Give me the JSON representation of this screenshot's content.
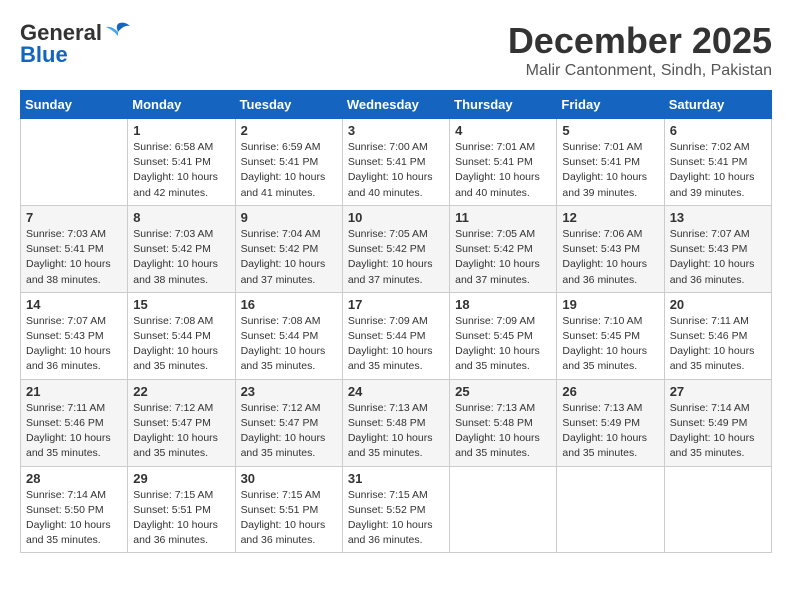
{
  "header": {
    "logo_line1": "General",
    "logo_line2": "Blue",
    "title": "December 2025",
    "subtitle": "Malir Cantonment, Sindh, Pakistan"
  },
  "weekdays": [
    "Sunday",
    "Monday",
    "Tuesday",
    "Wednesday",
    "Thursday",
    "Friday",
    "Saturday"
  ],
  "weeks": [
    [
      {
        "day": "",
        "info": ""
      },
      {
        "day": "1",
        "info": "Sunrise: 6:58 AM\nSunset: 5:41 PM\nDaylight: 10 hours\nand 42 minutes."
      },
      {
        "day": "2",
        "info": "Sunrise: 6:59 AM\nSunset: 5:41 PM\nDaylight: 10 hours\nand 41 minutes."
      },
      {
        "day": "3",
        "info": "Sunrise: 7:00 AM\nSunset: 5:41 PM\nDaylight: 10 hours\nand 40 minutes."
      },
      {
        "day": "4",
        "info": "Sunrise: 7:01 AM\nSunset: 5:41 PM\nDaylight: 10 hours\nand 40 minutes."
      },
      {
        "day": "5",
        "info": "Sunrise: 7:01 AM\nSunset: 5:41 PM\nDaylight: 10 hours\nand 39 minutes."
      },
      {
        "day": "6",
        "info": "Sunrise: 7:02 AM\nSunset: 5:41 PM\nDaylight: 10 hours\nand 39 minutes."
      }
    ],
    [
      {
        "day": "7",
        "info": "Sunrise: 7:03 AM\nSunset: 5:41 PM\nDaylight: 10 hours\nand 38 minutes."
      },
      {
        "day": "8",
        "info": "Sunrise: 7:03 AM\nSunset: 5:42 PM\nDaylight: 10 hours\nand 38 minutes."
      },
      {
        "day": "9",
        "info": "Sunrise: 7:04 AM\nSunset: 5:42 PM\nDaylight: 10 hours\nand 37 minutes."
      },
      {
        "day": "10",
        "info": "Sunrise: 7:05 AM\nSunset: 5:42 PM\nDaylight: 10 hours\nand 37 minutes."
      },
      {
        "day": "11",
        "info": "Sunrise: 7:05 AM\nSunset: 5:42 PM\nDaylight: 10 hours\nand 37 minutes."
      },
      {
        "day": "12",
        "info": "Sunrise: 7:06 AM\nSunset: 5:43 PM\nDaylight: 10 hours\nand 36 minutes."
      },
      {
        "day": "13",
        "info": "Sunrise: 7:07 AM\nSunset: 5:43 PM\nDaylight: 10 hours\nand 36 minutes."
      }
    ],
    [
      {
        "day": "14",
        "info": "Sunrise: 7:07 AM\nSunset: 5:43 PM\nDaylight: 10 hours\nand 36 minutes."
      },
      {
        "day": "15",
        "info": "Sunrise: 7:08 AM\nSunset: 5:44 PM\nDaylight: 10 hours\nand 35 minutes."
      },
      {
        "day": "16",
        "info": "Sunrise: 7:08 AM\nSunset: 5:44 PM\nDaylight: 10 hours\nand 35 minutes."
      },
      {
        "day": "17",
        "info": "Sunrise: 7:09 AM\nSunset: 5:44 PM\nDaylight: 10 hours\nand 35 minutes."
      },
      {
        "day": "18",
        "info": "Sunrise: 7:09 AM\nSunset: 5:45 PM\nDaylight: 10 hours\nand 35 minutes."
      },
      {
        "day": "19",
        "info": "Sunrise: 7:10 AM\nSunset: 5:45 PM\nDaylight: 10 hours\nand 35 minutes."
      },
      {
        "day": "20",
        "info": "Sunrise: 7:11 AM\nSunset: 5:46 PM\nDaylight: 10 hours\nand 35 minutes."
      }
    ],
    [
      {
        "day": "21",
        "info": "Sunrise: 7:11 AM\nSunset: 5:46 PM\nDaylight: 10 hours\nand 35 minutes."
      },
      {
        "day": "22",
        "info": "Sunrise: 7:12 AM\nSunset: 5:47 PM\nDaylight: 10 hours\nand 35 minutes."
      },
      {
        "day": "23",
        "info": "Sunrise: 7:12 AM\nSunset: 5:47 PM\nDaylight: 10 hours\nand 35 minutes."
      },
      {
        "day": "24",
        "info": "Sunrise: 7:13 AM\nSunset: 5:48 PM\nDaylight: 10 hours\nand 35 minutes."
      },
      {
        "day": "25",
        "info": "Sunrise: 7:13 AM\nSunset: 5:48 PM\nDaylight: 10 hours\nand 35 minutes."
      },
      {
        "day": "26",
        "info": "Sunrise: 7:13 AM\nSunset: 5:49 PM\nDaylight: 10 hours\nand 35 minutes."
      },
      {
        "day": "27",
        "info": "Sunrise: 7:14 AM\nSunset: 5:49 PM\nDaylight: 10 hours\nand 35 minutes."
      }
    ],
    [
      {
        "day": "28",
        "info": "Sunrise: 7:14 AM\nSunset: 5:50 PM\nDaylight: 10 hours\nand 35 minutes."
      },
      {
        "day": "29",
        "info": "Sunrise: 7:15 AM\nSunset: 5:51 PM\nDaylight: 10 hours\nand 36 minutes."
      },
      {
        "day": "30",
        "info": "Sunrise: 7:15 AM\nSunset: 5:51 PM\nDaylight: 10 hours\nand 36 minutes."
      },
      {
        "day": "31",
        "info": "Sunrise: 7:15 AM\nSunset: 5:52 PM\nDaylight: 10 hours\nand 36 minutes."
      },
      {
        "day": "",
        "info": ""
      },
      {
        "day": "",
        "info": ""
      },
      {
        "day": "",
        "info": ""
      }
    ]
  ]
}
